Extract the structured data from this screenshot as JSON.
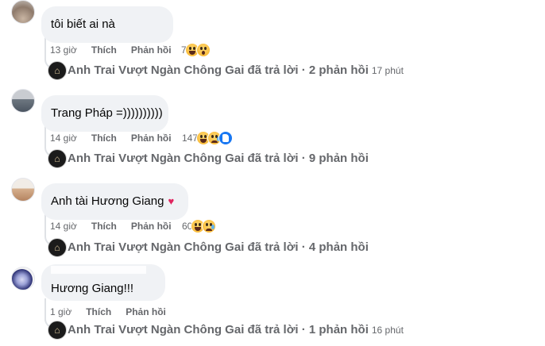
{
  "comments": [
    {
      "text": "tôi biết ai nà",
      "time": "13 giờ",
      "like_label": "Thích",
      "reply_label": "Phản hồi",
      "reaction_count": "7",
      "reactions": [
        "haha",
        "wow"
      ],
      "replies": {
        "text": "Anh Trai Vượt Ngàn Chông Gai đã trả lời · 2 phản hồi",
        "ago": "17 phút"
      }
    },
    {
      "text": "Trang Pháp =))))))))))",
      "time": "14 giờ",
      "like_label": "Thích",
      "reply_label": "Phản hồi",
      "reaction_count": "147",
      "reactions": [
        "haha",
        "sad",
        "like"
      ],
      "replies": {
        "text": "Anh Trai Vượt Ngàn Chông Gai đã trả lời · 9 phản hồi",
        "ago": ""
      }
    },
    {
      "text": "Anh tài Hương Giang",
      "emoji": "heart-arrow",
      "time": "14 giờ",
      "like_label": "Thích",
      "reply_label": "Phản hồi",
      "reaction_count": "60",
      "reactions": [
        "haha",
        "sad"
      ],
      "replies": {
        "text": "Anh Trai Vượt Ngàn Chông Gai đã trả lời · 4 phản hồi",
        "ago": ""
      }
    },
    {
      "text": "Hương Giang!!!",
      "time": "1 giờ",
      "like_label": "Thích",
      "reply_label": "Phản hồi",
      "replies": {
        "text": "Anh Trai Vượt Ngàn Chông Gai đã trả lời · 1 phản hồi",
        "ago": "16 phút"
      }
    }
  ],
  "colors": {
    "bubble": "#f0f2f5",
    "meta_text": "#65676b",
    "thread_line": "#dfe2e6"
  }
}
